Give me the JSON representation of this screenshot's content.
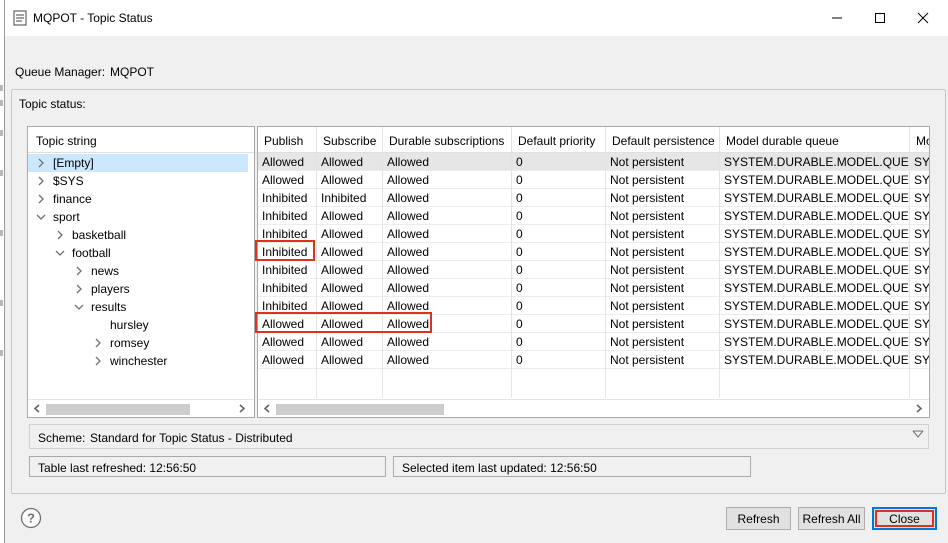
{
  "window": {
    "title": "MQPOT - Topic Status"
  },
  "queue_manager": {
    "label": "Queue Manager:",
    "value": "MQPOT"
  },
  "topic_status": {
    "group_label": "Topic status:",
    "tree_header": "Topic string",
    "tree": [
      {
        "label": "[Empty]",
        "expanded": false,
        "has_children": true,
        "selected": true
      },
      {
        "label": "$SYS",
        "expanded": false,
        "has_children": true
      },
      {
        "label": "finance",
        "expanded": false,
        "has_children": true
      },
      {
        "label": "sport",
        "expanded": true,
        "has_children": true
      },
      {
        "label": "basketball",
        "expanded": false,
        "has_children": true
      },
      {
        "label": "football",
        "expanded": true,
        "has_children": true
      },
      {
        "label": "news",
        "expanded": false,
        "has_children": true
      },
      {
        "label": "players",
        "expanded": false,
        "has_children": true
      },
      {
        "label": "results",
        "expanded": true,
        "has_children": true
      },
      {
        "label": "hursley",
        "expanded": false,
        "has_children": false
      },
      {
        "label": "romsey",
        "expanded": false,
        "has_children": true
      },
      {
        "label": "winchester",
        "expanded": false,
        "has_children": true
      }
    ],
    "columns": [
      "Publish",
      "Subscribe",
      "Durable subscriptions",
      "Default priority",
      "Default persistence",
      "Model durable queue",
      "Mo"
    ],
    "rows": [
      [
        "Allowed",
        "Allowed",
        "Allowed",
        "0",
        "Not persistent",
        "SYSTEM.DURABLE.MODEL.QUEUE",
        "SYS"
      ],
      [
        "Allowed",
        "Allowed",
        "Allowed",
        "0",
        "Not persistent",
        "SYSTEM.DURABLE.MODEL.QUEUE",
        "SYS"
      ],
      [
        "Inhibited",
        "Inhibited",
        "Allowed",
        "0",
        "Not persistent",
        "SYSTEM.DURABLE.MODEL.QUEUE",
        "SYS"
      ],
      [
        "Inhibited",
        "Allowed",
        "Allowed",
        "0",
        "Not persistent",
        "SYSTEM.DURABLE.MODEL.QUEUE",
        "SYS"
      ],
      [
        "Inhibited",
        "Allowed",
        "Allowed",
        "0",
        "Not persistent",
        "SYSTEM.DURABLE.MODEL.QUEUE",
        "SYS"
      ],
      [
        "Inhibited",
        "Allowed",
        "Allowed",
        "0",
        "Not persistent",
        "SYSTEM.DURABLE.MODEL.QUEUE",
        "SYS"
      ],
      [
        "Inhibited",
        "Allowed",
        "Allowed",
        "0",
        "Not persistent",
        "SYSTEM.DURABLE.MODEL.QUEUE",
        "SYS"
      ],
      [
        "Inhibited",
        "Allowed",
        "Allowed",
        "0",
        "Not persistent",
        "SYSTEM.DURABLE.MODEL.QUEUE",
        "SYS"
      ],
      [
        "Inhibited",
        "Allowed",
        "Allowed",
        "0",
        "Not persistent",
        "SYSTEM.DURABLE.MODEL.QUEUE",
        "SYS"
      ],
      [
        "Allowed",
        "Allowed",
        "Allowed",
        "0",
        "Not persistent",
        "SYSTEM.DURABLE.MODEL.QUEUE",
        "SYS"
      ],
      [
        "Allowed",
        "Allowed",
        "Allowed",
        "0",
        "Not persistent",
        "SYSTEM.DURABLE.MODEL.QUEUE",
        "SYS"
      ],
      [
        "Allowed",
        "Allowed",
        "Allowed",
        "0",
        "Not persistent",
        "SYSTEM.DURABLE.MODEL.QUEUE",
        "SYS"
      ]
    ]
  },
  "scheme": {
    "label": "Scheme:",
    "value": "Standard for Topic Status - Distributed"
  },
  "status": {
    "table_refreshed": "Table last refreshed: 12:56:50",
    "item_updated": "Selected item last updated: 12:56:50"
  },
  "buttons": {
    "refresh": "Refresh",
    "refresh_all": "Refresh All",
    "close": "Close"
  },
  "colors": {
    "highlight": "#e03020",
    "selection": "#cce8ff",
    "focus": "#0078d7"
  }
}
